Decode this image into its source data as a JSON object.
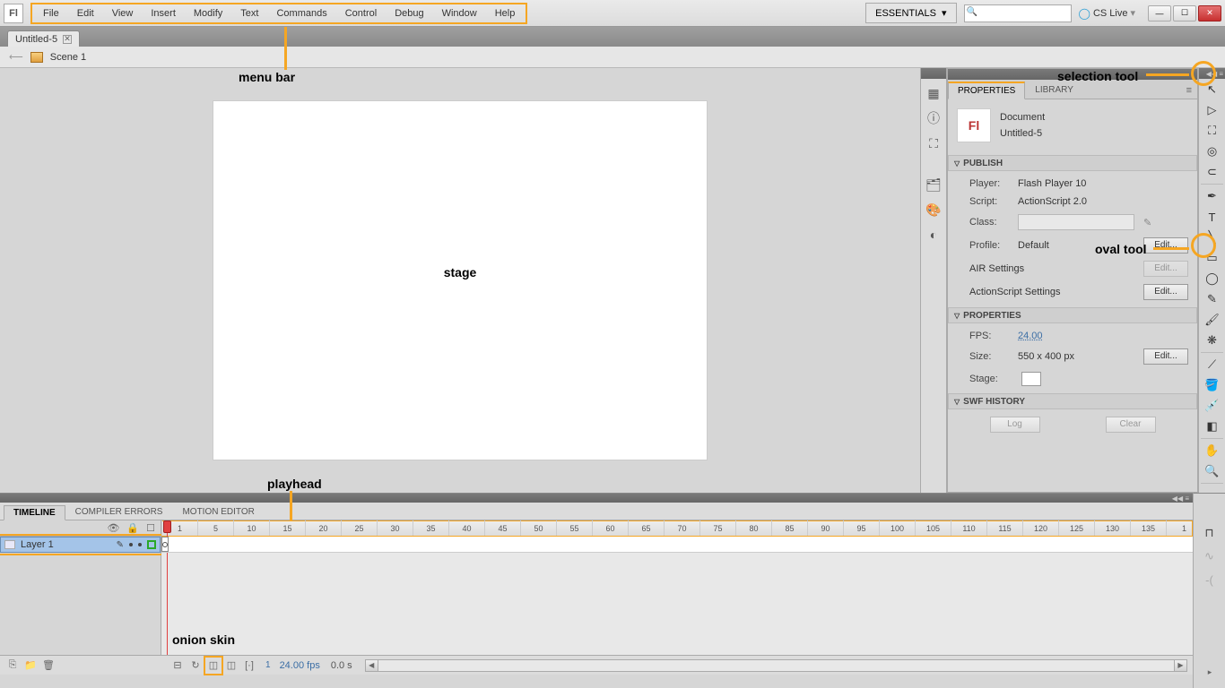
{
  "app_icon": "Fl",
  "menu": [
    "File",
    "Edit",
    "View",
    "Insert",
    "Modify",
    "Text",
    "Commands",
    "Control",
    "Debug",
    "Window",
    "Help"
  ],
  "workspace_label": "ESSENTIALS",
  "cslive_label": "CS Live",
  "doc_tab": "Untitled-5",
  "scene": "Scene 1",
  "panel_tabs": {
    "properties": "PROPERTIES",
    "library": "LIBRARY"
  },
  "document": {
    "type": "Document",
    "name": "Untitled-5"
  },
  "publish": {
    "title": "PUBLISH",
    "player_label": "Player:",
    "player_value": "Flash Player 10",
    "script_label": "Script:",
    "script_value": "ActionScript 2.0",
    "class_label": "Class:",
    "profile_label": "Profile:",
    "profile_value": "Default",
    "edit_label": "Edit...",
    "air_label": "AIR Settings",
    "as_label": "ActionScript Settings"
  },
  "propsec": {
    "title": "PROPERTIES",
    "fps_label": "FPS:",
    "fps_value": "24.00",
    "size_label": "Size:",
    "size_value": "550 x 400 px",
    "stage_label": "Stage:"
  },
  "swf": {
    "title": "SWF HISTORY",
    "log": "Log",
    "clear": "Clear"
  },
  "timeline": {
    "tabs": [
      "TIMELINE",
      "COMPILER ERRORS",
      "MOTION EDITOR"
    ],
    "layer": "Layer 1",
    "frame_num": "1",
    "fps": "24.00 fps",
    "secs": "0.0 s",
    "ruler": [
      "1",
      "5",
      "10",
      "15",
      "20",
      "25",
      "30",
      "35",
      "40",
      "45",
      "50",
      "55",
      "60",
      "65",
      "70",
      "75",
      "80",
      "85",
      "90",
      "95",
      "100",
      "105",
      "110",
      "115",
      "120",
      "125",
      "130",
      "135",
      "1"
    ]
  },
  "annotations": {
    "menu_bar": "menu bar",
    "stage": "stage",
    "playhead": "playhead",
    "onion_skin": "onion skin",
    "selection_tool": "selection tool",
    "oval_tool": "oval tool"
  }
}
